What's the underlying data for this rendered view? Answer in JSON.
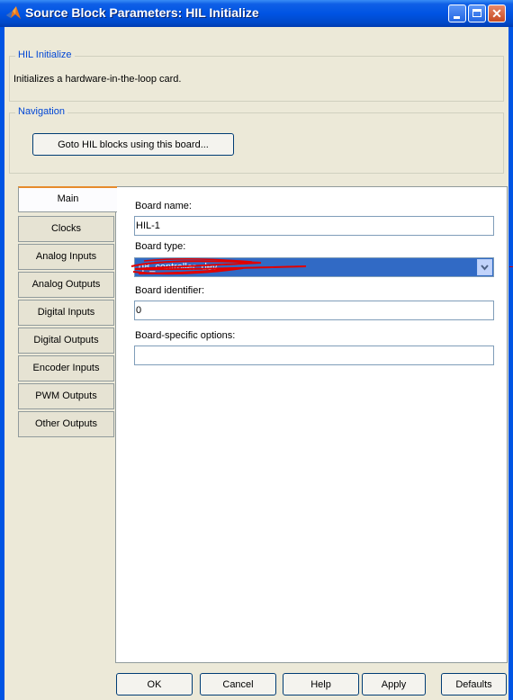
{
  "window": {
    "title": "Source Block Parameters: HIL Initialize",
    "icon": "matlab-logo-icon"
  },
  "description_group": {
    "legend": "HIL Initialize",
    "text": "Initializes a hardware-in-the-loop card."
  },
  "navigation_group": {
    "legend": "Navigation",
    "goto_button": "Goto HIL blocks using this board..."
  },
  "tabs": [
    {
      "label": "Main",
      "active": true
    },
    {
      "label": "Clocks"
    },
    {
      "label": "Analog Inputs"
    },
    {
      "label": "Analog Outputs"
    },
    {
      "label": "Digital Inputs"
    },
    {
      "label": "Digital Outputs"
    },
    {
      "label": "Encoder Inputs"
    },
    {
      "label": "PWM Outputs"
    },
    {
      "label": "Other Outputs"
    }
  ],
  "main": {
    "board_name_label": "Board name:",
    "board_name_value": "HIL-1",
    "board_type_label": "Board type:",
    "board_type_value": "q8_controller_dev",
    "board_identifier_label": "Board identifier:",
    "board_identifier_value": "0",
    "board_options_label": "Board-specific options:",
    "board_options_value": ""
  },
  "buttons": {
    "ok": "OK",
    "cancel": "Cancel",
    "help": "Help",
    "apply": "Apply",
    "defaults": "Defaults"
  },
  "colors": {
    "titlebar": "#0054e3",
    "selection": "#316ac5",
    "legend_text": "#0046d5",
    "active_tab_accent": "#e68b2c",
    "scribble": "#e00000"
  }
}
